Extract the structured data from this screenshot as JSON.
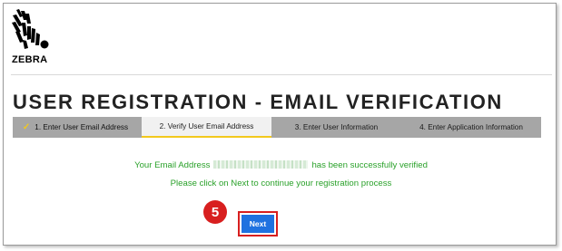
{
  "brand": {
    "name": "ZEBRA",
    "logo_icon": "zebra-head-icon"
  },
  "page": {
    "title": "USER REGISTRATION - EMAIL VERIFICATION"
  },
  "steps": [
    {
      "label": "1. Enter User Email Address",
      "state": "completed",
      "icon": "checkmark-icon"
    },
    {
      "label": "2. Verify User Email Address",
      "state": "active"
    },
    {
      "label": "3. Enter User Information",
      "state": "pending"
    },
    {
      "label": "4. Enter Application Information",
      "state": "pending"
    }
  ],
  "messages": {
    "verified_prefix": "Your Email Address",
    "verified_suffix": "has been successfully verified",
    "continue": "Please click on Next to continue your registration process"
  },
  "annotation": {
    "step_number": "5"
  },
  "actions": {
    "next_label": "Next"
  },
  "colors": {
    "success_text": "#2aa12a",
    "step_inactive": "#a6a6a6",
    "step_active": "#f1f1f1",
    "step_accent": "#f2c81c",
    "button": "#1f72e0",
    "annotation_red": "#d81f1f"
  }
}
